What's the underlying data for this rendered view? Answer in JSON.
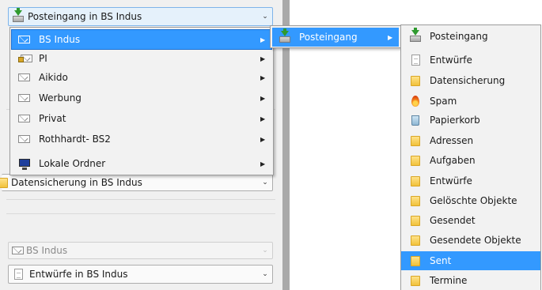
{
  "left_pane": {
    "top_combo": "Posteingang in BS Indus",
    "folder_combo": "Datensicherung in BS Indus",
    "account_combo": "BS Indus",
    "drafts_combo": "Entwürfe in BS Indus"
  },
  "menu_accounts": {
    "items": [
      {
        "label": "BS Indus",
        "icon": "envelope-icon",
        "highlighted": true
      },
      {
        "label": "PI",
        "icon": "locked-envelope-icon"
      },
      {
        "label": "Aikido",
        "icon": "envelope-icon"
      },
      {
        "label": "Werbung",
        "icon": "envelope-icon"
      },
      {
        "label": "Privat",
        "icon": "envelope-icon"
      },
      {
        "label": "Rothhardt- BS2",
        "icon": "envelope-icon"
      },
      {
        "label": "Lokale Ordner",
        "icon": "local-folders-icon"
      }
    ]
  },
  "menu_inbox": {
    "items": [
      {
        "label": "Posteingang",
        "icon": "inbox-icon",
        "highlighted": true
      }
    ]
  },
  "menu_folders": {
    "items": [
      {
        "label": "Posteingang",
        "icon": "inbox-icon"
      },
      {
        "label": "Entwürfe",
        "icon": "drafts-icon"
      },
      {
        "label": "Datensicherung",
        "icon": "folder-icon"
      },
      {
        "label": "Spam",
        "icon": "spam-icon"
      },
      {
        "label": "Papierkorb",
        "icon": "trash-icon"
      },
      {
        "label": "Adressen",
        "icon": "folder-icon"
      },
      {
        "label": "Aufgaben",
        "icon": "folder-icon"
      },
      {
        "label": "Entwürfe",
        "icon": "folder-icon"
      },
      {
        "label": "Gelöschte Objekte",
        "icon": "folder-icon"
      },
      {
        "label": "Gesendet",
        "icon": "folder-icon"
      },
      {
        "label": "Gesendete Objekte",
        "icon": "folder-icon"
      },
      {
        "label": "Sent",
        "icon": "folder-icon",
        "highlighted": true
      },
      {
        "label": "Termine",
        "icon": "folder-icon"
      }
    ]
  },
  "colors": {
    "highlight": "#3399ff",
    "menu_background": "#f2f2f2",
    "splitter": "#a9a9a9"
  }
}
